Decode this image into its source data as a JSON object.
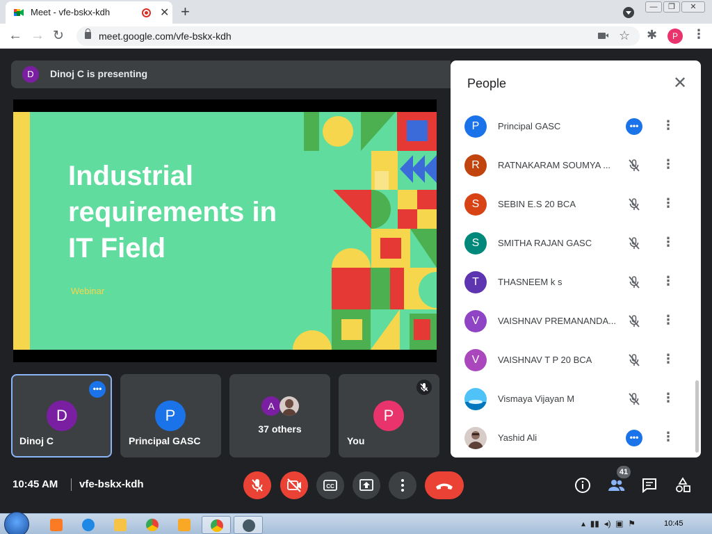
{
  "browser": {
    "tab_title": "Meet - vfe-bskx-kdh",
    "url": "meet.google.com/vfe-bskx-kdh",
    "profile_initial": "P"
  },
  "meet": {
    "presenting_banner": "Dinoj C is presenting",
    "presenter_initial": "D",
    "slide": {
      "title": "Industrial requirements in IT Field",
      "subtitle": "Webinar"
    },
    "tiles": [
      {
        "initial": "D",
        "name": "Dinoj C",
        "color": "#7b1fa2"
      },
      {
        "initial": "P",
        "name": "Principal GASC",
        "color": "#1a73e8"
      },
      {
        "initial": "A",
        "name": "37 others",
        "color": "#7b1fa2"
      },
      {
        "initial": "P",
        "name": "You",
        "color": "#e8336d"
      }
    ],
    "meeting_time": "10:45 AM",
    "meeting_code": "vfe-bskx-kdh",
    "people_count": "41"
  },
  "people": {
    "title": "People",
    "list": [
      {
        "initial": "P",
        "name": "Principal GASC",
        "color": "#1a73e8",
        "status": "more"
      },
      {
        "initial": "R",
        "name": "RATNAKARAM SOUMYA ...",
        "color": "#c1440e",
        "status": "muted"
      },
      {
        "initial": "S",
        "name": "SEBIN E.S 20 BCA",
        "color": "#d84315",
        "status": "muted"
      },
      {
        "initial": "S",
        "name": "SMITHA RAJAN GASC",
        "color": "#00897b",
        "status": "muted"
      },
      {
        "initial": "T",
        "name": "THASNEEM k s",
        "color": "#5e35b1",
        "status": "muted"
      },
      {
        "initial": "V",
        "name": "VAISHNAV PREMANANDA...",
        "color": "#8e44c4",
        "status": "muted"
      },
      {
        "initial": "V",
        "name": "VAISHNAV T P 20 BCA",
        "color": "#ab47bc",
        "status": "muted"
      },
      {
        "initial": "",
        "name": "Vismaya Vijayan M",
        "color": "#4fc3f7",
        "status": "muted"
      },
      {
        "initial": "",
        "name": "Yashid Ali",
        "color": "#8d6e63",
        "status": "more"
      }
    ]
  },
  "taskbar": {
    "clock": "10:45"
  }
}
